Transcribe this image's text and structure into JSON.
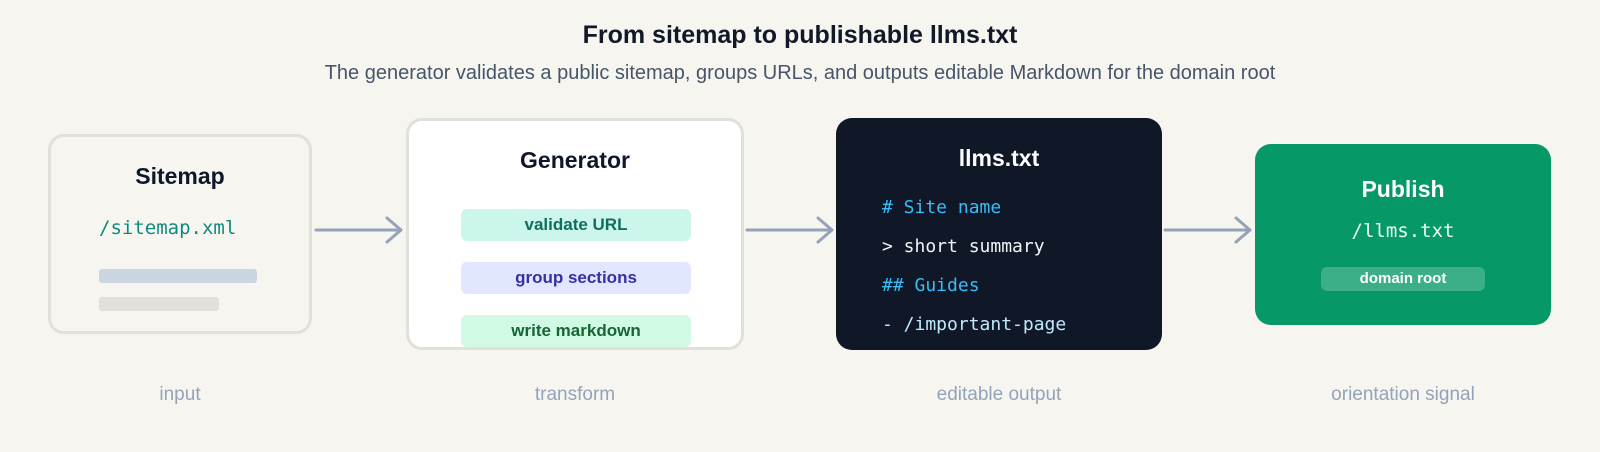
{
  "header": {
    "title": "From sitemap to publishable llms.txt",
    "subtitle": "The generator validates a public sitemap, groups URLs, and outputs editable Markdown for the domain root"
  },
  "stages": {
    "sitemap": {
      "title": "Sitemap",
      "path": "/sitemap.xml",
      "label": "input"
    },
    "generator": {
      "title": "Generator",
      "steps": [
        "validate URL",
        "group sections",
        "write markdown"
      ],
      "label": "transform"
    },
    "llms": {
      "title": "llms.txt",
      "lines": [
        "# Site name",
        "> short summary",
        "## Guides",
        "- /important-page"
      ],
      "label": "editable output"
    },
    "publish": {
      "title": "Publish",
      "path": "/llms.txt",
      "badge": "domain root",
      "label": "orientation signal"
    }
  },
  "colors": {
    "background": "#f6f5f0",
    "arrow": "#94a3b8",
    "dark_card": "#101828",
    "publish_green": "#069867",
    "teal_text": "#0f8a80",
    "code_blue": "#38bdf8"
  },
  "icons": {
    "arrow": "arrow-right-icon"
  }
}
